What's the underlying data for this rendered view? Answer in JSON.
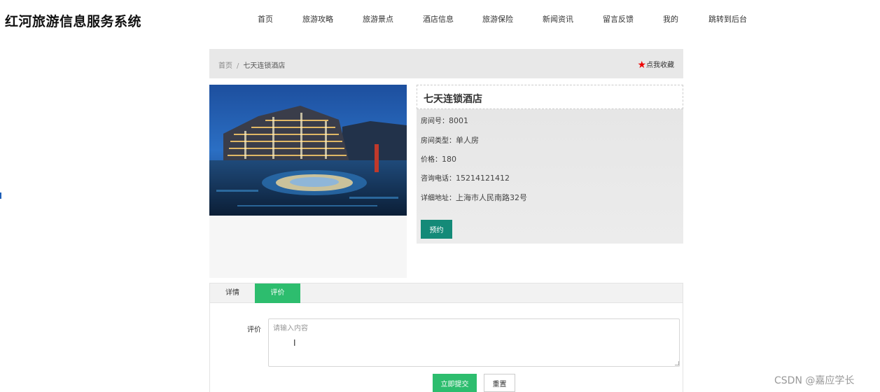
{
  "header": {
    "site_title": "红河旅游信息服务系统",
    "nav": [
      "首页",
      "旅游攻略",
      "旅游景点",
      "酒店信息",
      "旅游保险",
      "新闻资讯",
      "留言反馈",
      "我的",
      "跳转到后台"
    ]
  },
  "breadcrumb": {
    "home": "首页",
    "separator": "/",
    "current": "七天连锁酒店"
  },
  "favorite": {
    "icon": "star-icon",
    "label": "点我收藏",
    "color": "#ee0000"
  },
  "hotel": {
    "title": "七天连锁酒店",
    "fields": [
      {
        "label": "房间号：",
        "value": "8001"
      },
      {
        "label": "房间类型：",
        "value": "单人房"
      },
      {
        "label": "价格：",
        "value": "180"
      },
      {
        "label": "咨询电话：",
        "value": "15214121412"
      },
      {
        "label": "详细地址：",
        "value": "上海市人民南路32号"
      }
    ],
    "book_label": "预约"
  },
  "tabs": {
    "detail": "详情",
    "review": "评价",
    "active": "评价"
  },
  "review_form": {
    "label": "评价",
    "placeholder": "请输入内容",
    "submit_label": "立即提交",
    "reset_label": "重置"
  },
  "colors": {
    "accent_green": "#2dbd6e",
    "book_button": "#148a78"
  },
  "watermark": "CSDN @嘉应学长"
}
